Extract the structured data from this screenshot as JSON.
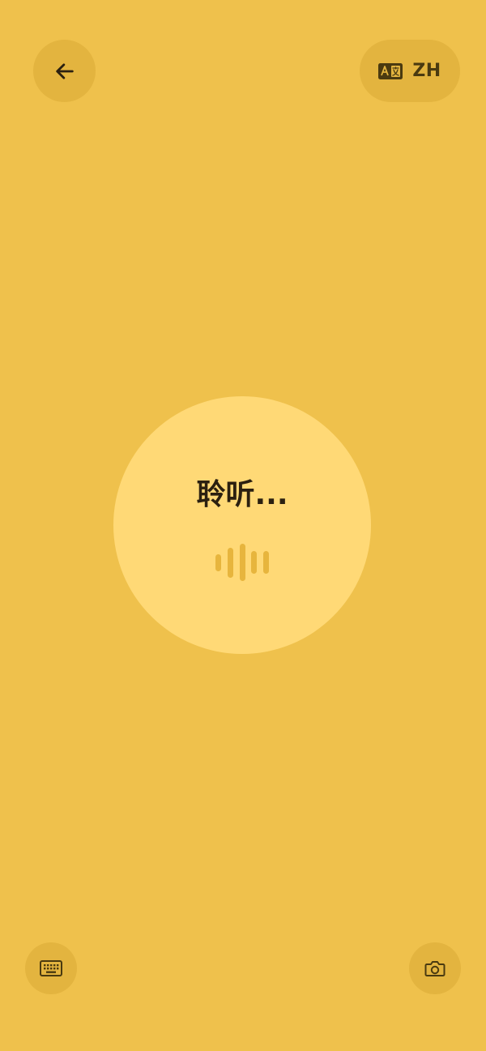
{
  "header": {
    "back_icon": "arrow-left-icon",
    "language": {
      "icon": "translate-icon",
      "code": "ZH"
    }
  },
  "listening": {
    "status_text": "聆听...",
    "wave_icon": "sound-wave-icon",
    "wave_levels": [
      0.45,
      0.8,
      1.0,
      0.6,
      0.6
    ]
  },
  "footer": {
    "keyboard_icon": "keyboard-icon",
    "camera_icon": "camera-icon"
  },
  "colors": {
    "background": "#EFC14C",
    "button_bg": "#E3B43F",
    "circle_bg": "#FFD976",
    "wave": "#E7B53D",
    "icon": "#2B2010"
  }
}
